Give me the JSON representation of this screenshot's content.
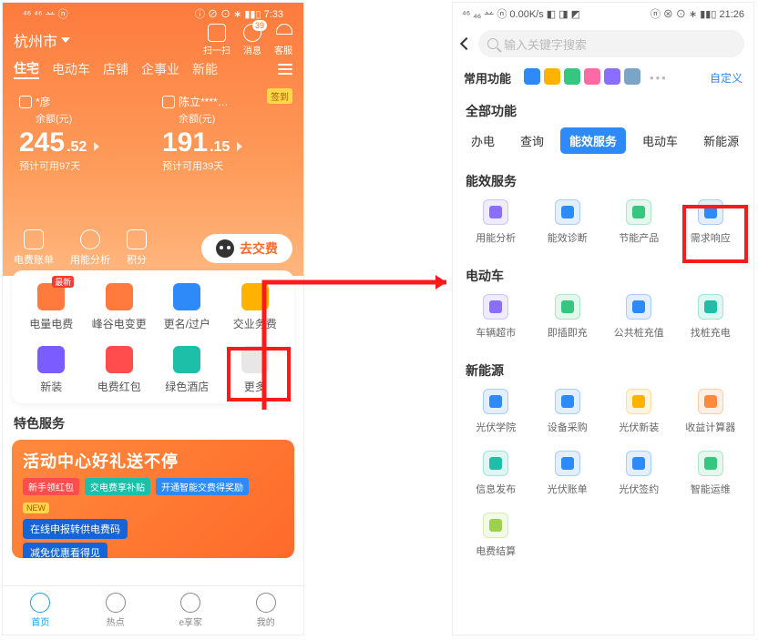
{
  "left": {
    "status": {
      "left": "⁴⁶ ⁴⁶ 䒑 ⓝ",
      "right": "ⓘ ⊘ ⊙ ∗ ▮▮▯ 7:33"
    },
    "location": "杭州市",
    "top_icons": [
      {
        "name": "scan-icon",
        "label": "扫一扫",
        "badge": ""
      },
      {
        "name": "message-icon",
        "label": "消息",
        "badge": "39"
      },
      {
        "name": "service-icon",
        "label": "客服",
        "badge": ""
      }
    ],
    "tabs": [
      "住宅",
      "电动车",
      "店铺",
      "企事业",
      "新能"
    ],
    "accounts": [
      {
        "name": "*彦",
        "sub": "余额(元)",
        "int": "245",
        "dec": ".52",
        "est": "预计可用97天",
        "qd": ""
      },
      {
        "name": "陈立****…",
        "sub": "余额(元)",
        "int": "191",
        "dec": ".15",
        "est": "预计可用39天",
        "qd": "签到"
      }
    ],
    "actions": [
      {
        "name": "bill-icon",
        "label": "电费账单"
      },
      {
        "name": "usage-icon",
        "label": "用能分析"
      },
      {
        "name": "points-icon",
        "label": "积分"
      }
    ],
    "pay_label": "去交费",
    "grid": [
      {
        "label": "电量电费",
        "color": "orange",
        "badge": "最新"
      },
      {
        "label": "峰谷电变更",
        "color": "orange",
        "badge": ""
      },
      {
        "label": "更名/过户",
        "color": "blue",
        "badge": ""
      },
      {
        "label": "交业务费",
        "color": "yellow",
        "badge": ""
      },
      {
        "label": "新装",
        "color": "purple",
        "badge": ""
      },
      {
        "label": "电费红包",
        "color": "red",
        "badge": ""
      },
      {
        "label": "绿色酒店",
        "color": "teal",
        "badge": ""
      },
      {
        "label": "更多",
        "color": "grey",
        "badge": ""
      }
    ],
    "special_title": "特色服务",
    "promo": {
      "title": "活动中心好礼送不停",
      "tags": [
        "新手领红包",
        "交电费享补贴",
        "开通智能交费得奖励"
      ],
      "new": "NEW",
      "line1": "在线申报转供电费码",
      "line2": "减免优惠看得见"
    },
    "tabbar": [
      {
        "name": "home-tab",
        "label": "首页"
      },
      {
        "name": "hot-tab",
        "label": "热点"
      },
      {
        "name": "family-tab",
        "label": "e享家"
      },
      {
        "name": "mine-tab",
        "label": "我的"
      }
    ]
  },
  "right": {
    "status": {
      "left": "⁴⁶ ₄₆ 䒑 ⓝ 0.00K/s ◧ ◨ ◩",
      "right": "ⓝ ⊗ ⊙ ∗ ▮▮▯ 21:26"
    },
    "search_placeholder": "输入关键字搜索",
    "freq_label": "常用功能",
    "freq_custom": "自定义",
    "freq_colors": [
      "#2d8af8",
      "#ffb300",
      "#35c77f",
      "#ff6aa6",
      "#8a6eff",
      "#7aa5c9"
    ],
    "all_title": "全部功能",
    "tabs": [
      "办电",
      "查询",
      "能效服务",
      "电动车",
      "新能源"
    ],
    "sections": [
      {
        "title": "能效服务",
        "items": [
          {
            "label": "用能分析",
            "color": "#8a6eff"
          },
          {
            "label": "能效诊断",
            "color": "#2d8af8"
          },
          {
            "label": "节能产品",
            "color": "#35c77f"
          },
          {
            "label": "需求响应",
            "color": "#2d8af8"
          }
        ]
      },
      {
        "title": "电动车",
        "items": [
          {
            "label": "车辆超市",
            "color": "#8a6eff"
          },
          {
            "label": "即插即充",
            "color": "#35c77f"
          },
          {
            "label": "公共桩充值",
            "color": "#2d8af8"
          },
          {
            "label": "找桩充电",
            "color": "#1dbfa8"
          }
        ]
      },
      {
        "title": "新能源",
        "items": [
          {
            "label": "光伏学院",
            "color": "#2d8af8"
          },
          {
            "label": "设备采购",
            "color": "#2d8af8"
          },
          {
            "label": "光伏新装",
            "color": "#ffb300"
          },
          {
            "label": "收益计算器",
            "color": "#ff8a3d"
          },
          {
            "label": "信息发布",
            "color": "#1dbfa8"
          },
          {
            "label": "光伏账单",
            "color": "#2d8af8"
          },
          {
            "label": "光伏签约",
            "color": "#2d8af8"
          },
          {
            "label": "智能运维",
            "color": "#35c77f"
          },
          {
            "label": "电费结算",
            "color": "#9bd14c"
          }
        ]
      }
    ]
  }
}
